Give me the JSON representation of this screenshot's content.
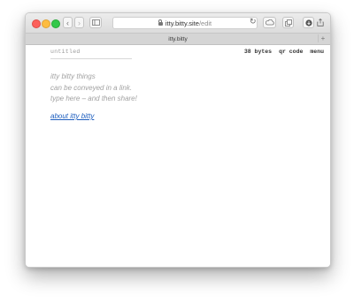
{
  "browser": {
    "address_host": "itty.bitty.site",
    "address_path": "/edit",
    "tab_title": "itty.bitty",
    "new_tab": "+"
  },
  "page": {
    "doc_title": "untitled",
    "size": "38 bytes",
    "qr_code": "qr code",
    "menu": "menu",
    "lines": [
      "itty bitty things",
      "can be conveyed in a link.",
      "type here – and then share!"
    ],
    "about_link": "about itty bitty"
  }
}
